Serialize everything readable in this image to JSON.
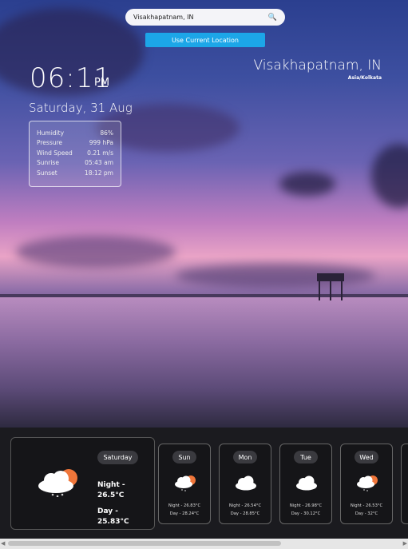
{
  "search": {
    "value": "Visakhapatnam, IN",
    "icon": "search-icon"
  },
  "location_button": "Use Current Location",
  "location": {
    "city": "Visakhapatnam, IN",
    "timezone": "Asia/Kolkata"
  },
  "clock": {
    "time": "06:11",
    "ampm": "PM",
    "date": "Saturday, 31 Aug"
  },
  "details": [
    {
      "label": "Humidity",
      "value": "86%"
    },
    {
      "label": "Pressure",
      "value": "999 hPa"
    },
    {
      "label": "Wind Speed",
      "value": "0.21 m/s"
    },
    {
      "label": "Sunrise",
      "value": "05:43 am"
    },
    {
      "label": "Sunset",
      "value": "18:12 pm"
    }
  ],
  "today": {
    "day": "Saturday",
    "night_label": "Night -",
    "night_temp": "26.5°C",
    "day_label": "Day -",
    "day_temp": "25.83°C",
    "icon": "cloud-sun-rain-icon"
  },
  "forecast": [
    {
      "day": "Sun",
      "night": "Night - 26.83°C",
      "dayt": "Day - 28.24°C",
      "icon": "cloud-sun-rain-icon"
    },
    {
      "day": "Mon",
      "night": "Night - 26.54°C",
      "dayt": "Day - 28.85°C",
      "icon": "cloud-icon"
    },
    {
      "day": "Tue",
      "night": "Night - 26.98°C",
      "dayt": "Day - 30.12°C",
      "icon": "cloud-icon"
    },
    {
      "day": "Wed",
      "night": "Night - 26.53°C",
      "dayt": "Day - 32°C",
      "icon": "cloud-sun-rain-icon"
    }
  ],
  "colors": {
    "accent": "#1ca6e8",
    "sun": "#f0763a",
    "panel": "#1b1b1f"
  }
}
